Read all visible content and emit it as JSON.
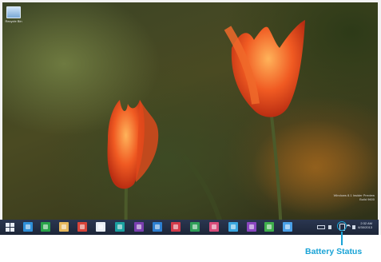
{
  "desktop": {
    "icon_label": "Recycle Bin"
  },
  "watermark": {
    "line1": "Windows 8.1 Insider Preview",
    "line2": "Build 9600"
  },
  "taskbar": {
    "items": [
      {
        "name": "start-button",
        "icon": "windows-logo-icon",
        "color": "#e8eef8"
      },
      {
        "name": "internet-explorer",
        "icon": "ie-icon",
        "color": "#2f8fd8"
      },
      {
        "name": "store",
        "icon": "store-icon",
        "color": "#29a34a"
      },
      {
        "name": "file-explorer",
        "icon": "folder-icon",
        "color": "#e6b85c"
      },
      {
        "name": "app-red",
        "icon": "red-app-icon",
        "color": "#d8443a"
      },
      {
        "name": "app-document",
        "icon": "document-icon",
        "color": "#e9eef4"
      },
      {
        "name": "app-teal",
        "icon": "teal-app-icon",
        "color": "#1aa0a0"
      },
      {
        "name": "app-purple",
        "icon": "purple-app-icon",
        "color": "#7a3fb0"
      },
      {
        "name": "app-blue",
        "icon": "blue-app-icon",
        "color": "#2d7fd1"
      },
      {
        "name": "app-red2",
        "icon": "red-app-icon",
        "color": "#d33b4a"
      },
      {
        "name": "app-green",
        "icon": "green-app-icon",
        "color": "#2f9e58"
      },
      {
        "name": "app-pink",
        "icon": "pink-app-icon",
        "color": "#d84c7a"
      },
      {
        "name": "app-cloud",
        "icon": "cloud-icon",
        "color": "#3aa6e0"
      },
      {
        "name": "app-violet",
        "icon": "violet-app-icon",
        "color": "#8a46c0"
      },
      {
        "name": "app-green2",
        "icon": "green-app-icon",
        "color": "#3fae4c"
      },
      {
        "name": "app-lightblue",
        "icon": "blue-app-icon",
        "color": "#4aa0e8"
      }
    ],
    "tray": {
      "clock_time": "2:32 AM",
      "clock_date": "6/30/2013"
    }
  },
  "callout": {
    "label": "Battery Status",
    "accent_color": "#19a3d6"
  }
}
